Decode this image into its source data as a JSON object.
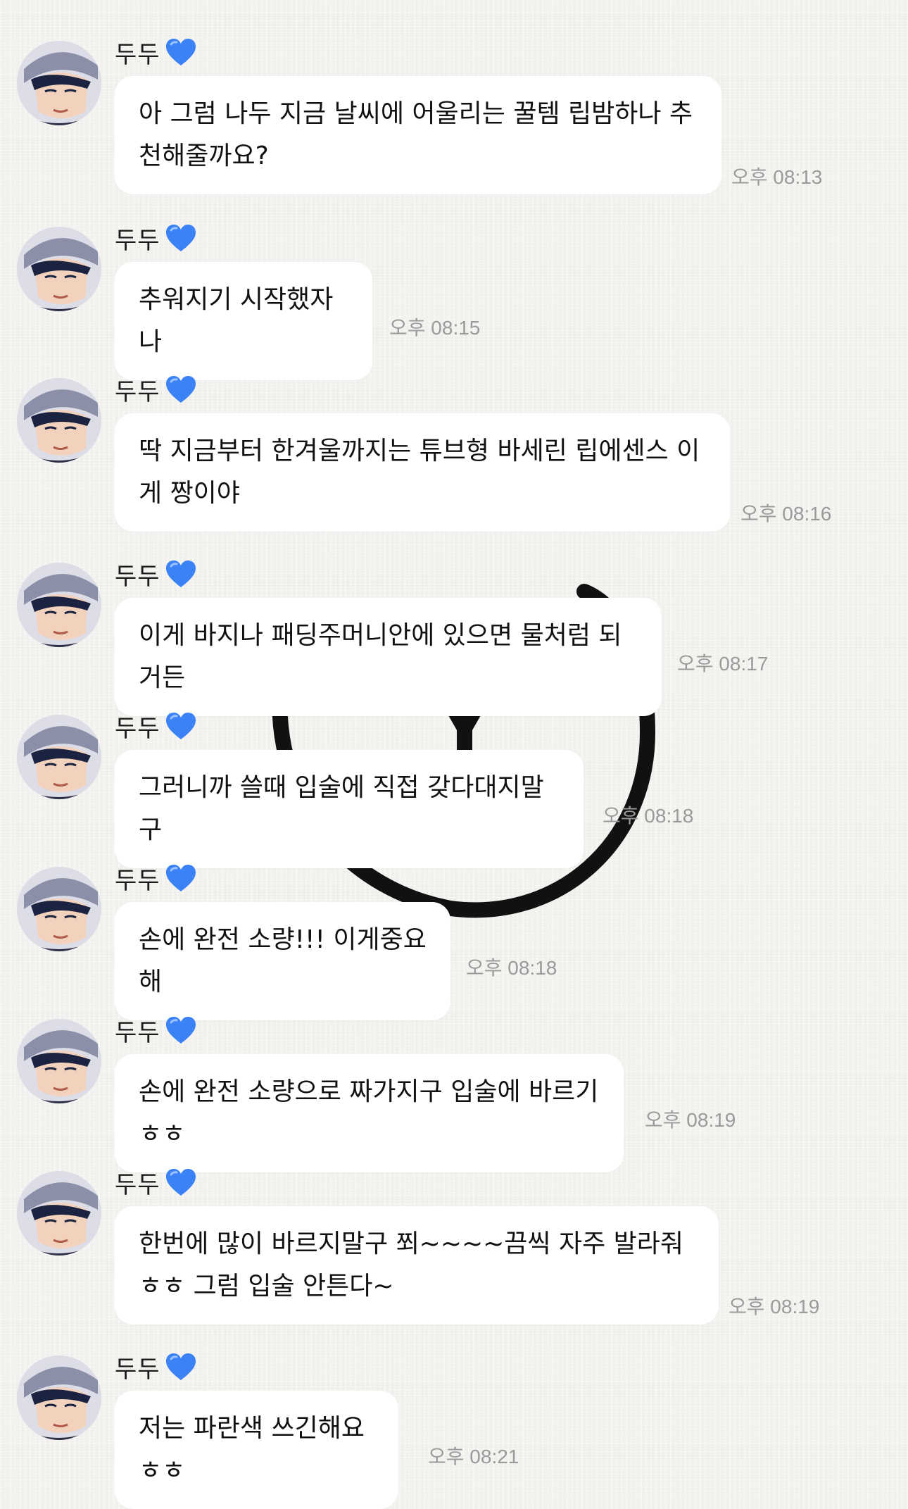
{
  "sender": {
    "name": "두두",
    "heart_icon": "blue-heart-icon",
    "heart_color": "#3b82f6"
  },
  "messages": [
    {
      "text": "아 그럼 나두 지금 날씨에 어울리는 꿀템 립밤하나 추천해줄까요?",
      "time": "오후 08:13"
    },
    {
      "text": "추워지기 시작했자나",
      "time": "오후 08:15"
    },
    {
      "text": "딱 지금부터 한겨울까지는 튜브형 바세린 립에센스 이게 짱이야",
      "time": "오후 08:16"
    },
    {
      "text": "이게 바지나 패딩주머니안에 있으면 물처럼 되거든",
      "time": "오후 08:17"
    },
    {
      "text": "그러니까 쓸때 입술에 직접 갖다대지말구",
      "time": "오후 08:18"
    },
    {
      "text": "손에 완전 소량!!! 이게중요해",
      "time": "오후 08:18"
    },
    {
      "text": "손에 완전 소량으로 짜가지구 입술에 바르기ㅎㅎ",
      "time": "오후 08:19"
    },
    {
      "text": "한번에 많이 바르지말구 쬐~~~~끔씩 자주 발라줘ㅎㅎ 그럼 입술 안튼다~",
      "time": "오후 08:19"
    },
    {
      "text": "저는 파란색 쓰긴해요ㅎㅎ",
      "time": "오후 08:21"
    }
  ]
}
